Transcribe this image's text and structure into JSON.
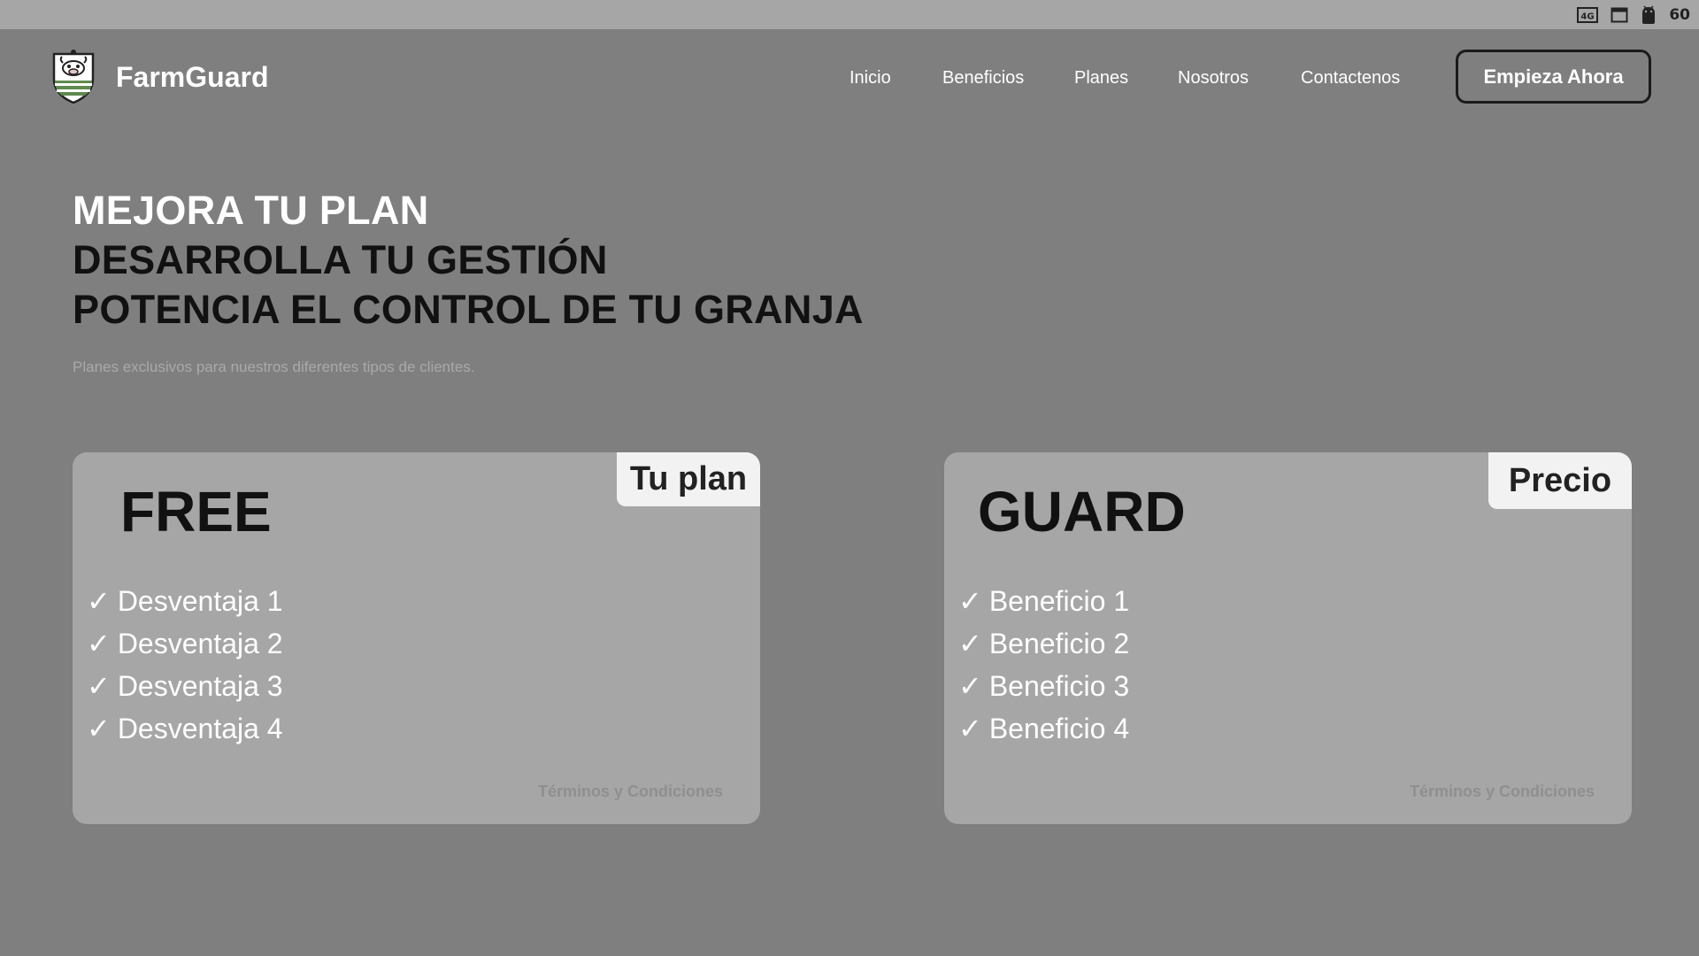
{
  "status_bar": {
    "icons": [
      "4g-icon",
      "window-icon",
      "android-icon"
    ],
    "network_label": "4G",
    "battery_text": "60"
  },
  "header": {
    "brand": "FarmGuard",
    "logo_icon": "farm-shield-logo",
    "nav": [
      "Inicio",
      "Beneficios",
      "Planes",
      "Nosotros",
      "Contactenos"
    ],
    "cta_label": "Empieza Ahora"
  },
  "hero": {
    "line1": "MEJORA TU PLAN",
    "line2": "DESARROLLA TU GESTIÓN",
    "line3": "POTENCIA EL CONTROL DE TU GRANJA",
    "subtitle": "Planes exclusivos para nuestros diferentes tipos de clientes."
  },
  "plans": [
    {
      "tag": "Tu plan",
      "title": "FREE",
      "items": [
        "Desventaja 1",
        "Desventaja 2",
        "Desventaja 3",
        "Desventaja 4"
      ],
      "terms": "Términos y Condiciones"
    },
    {
      "tag": "Precio",
      "title": "GUARD",
      "items": [
        "Beneficio 1",
        "Beneficio 2",
        "Beneficio 3",
        "Beneficio 4"
      ],
      "terms": "Términos y Condiciones"
    }
  ],
  "check_glyph": "✓",
  "colors": {
    "background": "#7f7f7f",
    "card": "#a6a6a6",
    "tag": "#f2f2f2",
    "shield_green": "#5f8a4f",
    "text_dark": "#111111",
    "text_light": "#ffffff"
  }
}
